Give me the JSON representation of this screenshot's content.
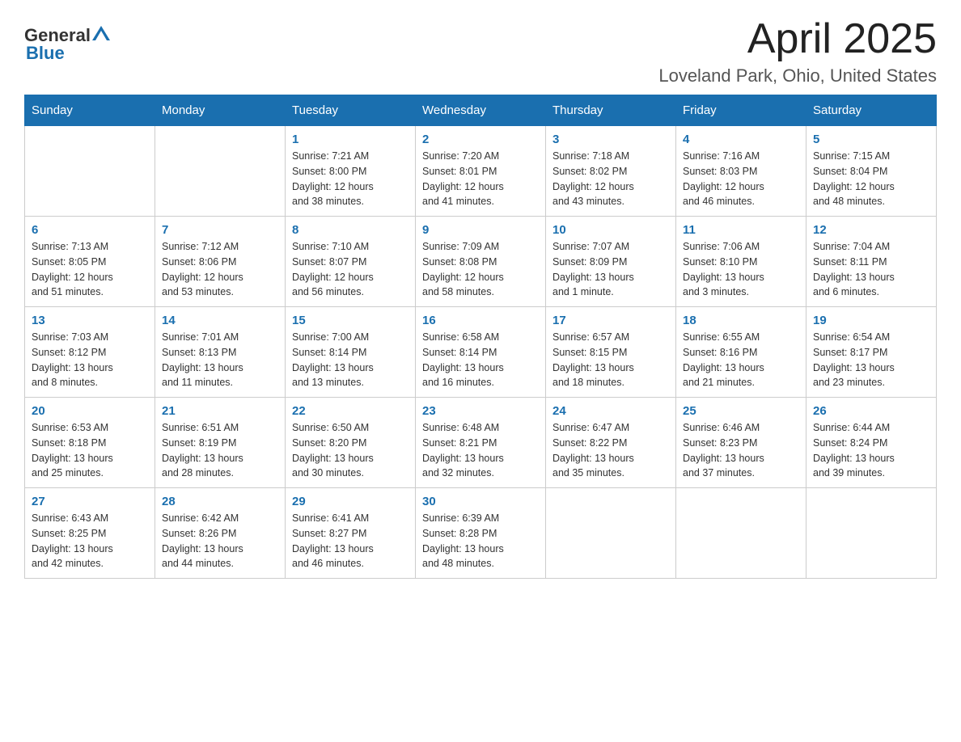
{
  "header": {
    "logo_general": "General",
    "logo_blue": "Blue",
    "title": "April 2025",
    "subtitle": "Loveland Park, Ohio, United States"
  },
  "days_of_week": [
    "Sunday",
    "Monday",
    "Tuesday",
    "Wednesday",
    "Thursday",
    "Friday",
    "Saturday"
  ],
  "weeks": [
    [
      {
        "day": "",
        "info": ""
      },
      {
        "day": "",
        "info": ""
      },
      {
        "day": "1",
        "info": "Sunrise: 7:21 AM\nSunset: 8:00 PM\nDaylight: 12 hours\nand 38 minutes."
      },
      {
        "day": "2",
        "info": "Sunrise: 7:20 AM\nSunset: 8:01 PM\nDaylight: 12 hours\nand 41 minutes."
      },
      {
        "day": "3",
        "info": "Sunrise: 7:18 AM\nSunset: 8:02 PM\nDaylight: 12 hours\nand 43 minutes."
      },
      {
        "day": "4",
        "info": "Sunrise: 7:16 AM\nSunset: 8:03 PM\nDaylight: 12 hours\nand 46 minutes."
      },
      {
        "day": "5",
        "info": "Sunrise: 7:15 AM\nSunset: 8:04 PM\nDaylight: 12 hours\nand 48 minutes."
      }
    ],
    [
      {
        "day": "6",
        "info": "Sunrise: 7:13 AM\nSunset: 8:05 PM\nDaylight: 12 hours\nand 51 minutes."
      },
      {
        "day": "7",
        "info": "Sunrise: 7:12 AM\nSunset: 8:06 PM\nDaylight: 12 hours\nand 53 minutes."
      },
      {
        "day": "8",
        "info": "Sunrise: 7:10 AM\nSunset: 8:07 PM\nDaylight: 12 hours\nand 56 minutes."
      },
      {
        "day": "9",
        "info": "Sunrise: 7:09 AM\nSunset: 8:08 PM\nDaylight: 12 hours\nand 58 minutes."
      },
      {
        "day": "10",
        "info": "Sunrise: 7:07 AM\nSunset: 8:09 PM\nDaylight: 13 hours\nand 1 minute."
      },
      {
        "day": "11",
        "info": "Sunrise: 7:06 AM\nSunset: 8:10 PM\nDaylight: 13 hours\nand 3 minutes."
      },
      {
        "day": "12",
        "info": "Sunrise: 7:04 AM\nSunset: 8:11 PM\nDaylight: 13 hours\nand 6 minutes."
      }
    ],
    [
      {
        "day": "13",
        "info": "Sunrise: 7:03 AM\nSunset: 8:12 PM\nDaylight: 13 hours\nand 8 minutes."
      },
      {
        "day": "14",
        "info": "Sunrise: 7:01 AM\nSunset: 8:13 PM\nDaylight: 13 hours\nand 11 minutes."
      },
      {
        "day": "15",
        "info": "Sunrise: 7:00 AM\nSunset: 8:14 PM\nDaylight: 13 hours\nand 13 minutes."
      },
      {
        "day": "16",
        "info": "Sunrise: 6:58 AM\nSunset: 8:14 PM\nDaylight: 13 hours\nand 16 minutes."
      },
      {
        "day": "17",
        "info": "Sunrise: 6:57 AM\nSunset: 8:15 PM\nDaylight: 13 hours\nand 18 minutes."
      },
      {
        "day": "18",
        "info": "Sunrise: 6:55 AM\nSunset: 8:16 PM\nDaylight: 13 hours\nand 21 minutes."
      },
      {
        "day": "19",
        "info": "Sunrise: 6:54 AM\nSunset: 8:17 PM\nDaylight: 13 hours\nand 23 minutes."
      }
    ],
    [
      {
        "day": "20",
        "info": "Sunrise: 6:53 AM\nSunset: 8:18 PM\nDaylight: 13 hours\nand 25 minutes."
      },
      {
        "day": "21",
        "info": "Sunrise: 6:51 AM\nSunset: 8:19 PM\nDaylight: 13 hours\nand 28 minutes."
      },
      {
        "day": "22",
        "info": "Sunrise: 6:50 AM\nSunset: 8:20 PM\nDaylight: 13 hours\nand 30 minutes."
      },
      {
        "day": "23",
        "info": "Sunrise: 6:48 AM\nSunset: 8:21 PM\nDaylight: 13 hours\nand 32 minutes."
      },
      {
        "day": "24",
        "info": "Sunrise: 6:47 AM\nSunset: 8:22 PM\nDaylight: 13 hours\nand 35 minutes."
      },
      {
        "day": "25",
        "info": "Sunrise: 6:46 AM\nSunset: 8:23 PM\nDaylight: 13 hours\nand 37 minutes."
      },
      {
        "day": "26",
        "info": "Sunrise: 6:44 AM\nSunset: 8:24 PM\nDaylight: 13 hours\nand 39 minutes."
      }
    ],
    [
      {
        "day": "27",
        "info": "Sunrise: 6:43 AM\nSunset: 8:25 PM\nDaylight: 13 hours\nand 42 minutes."
      },
      {
        "day": "28",
        "info": "Sunrise: 6:42 AM\nSunset: 8:26 PM\nDaylight: 13 hours\nand 44 minutes."
      },
      {
        "day": "29",
        "info": "Sunrise: 6:41 AM\nSunset: 8:27 PM\nDaylight: 13 hours\nand 46 minutes."
      },
      {
        "day": "30",
        "info": "Sunrise: 6:39 AM\nSunset: 8:28 PM\nDaylight: 13 hours\nand 48 minutes."
      },
      {
        "day": "",
        "info": ""
      },
      {
        "day": "",
        "info": ""
      },
      {
        "day": "",
        "info": ""
      }
    ]
  ]
}
